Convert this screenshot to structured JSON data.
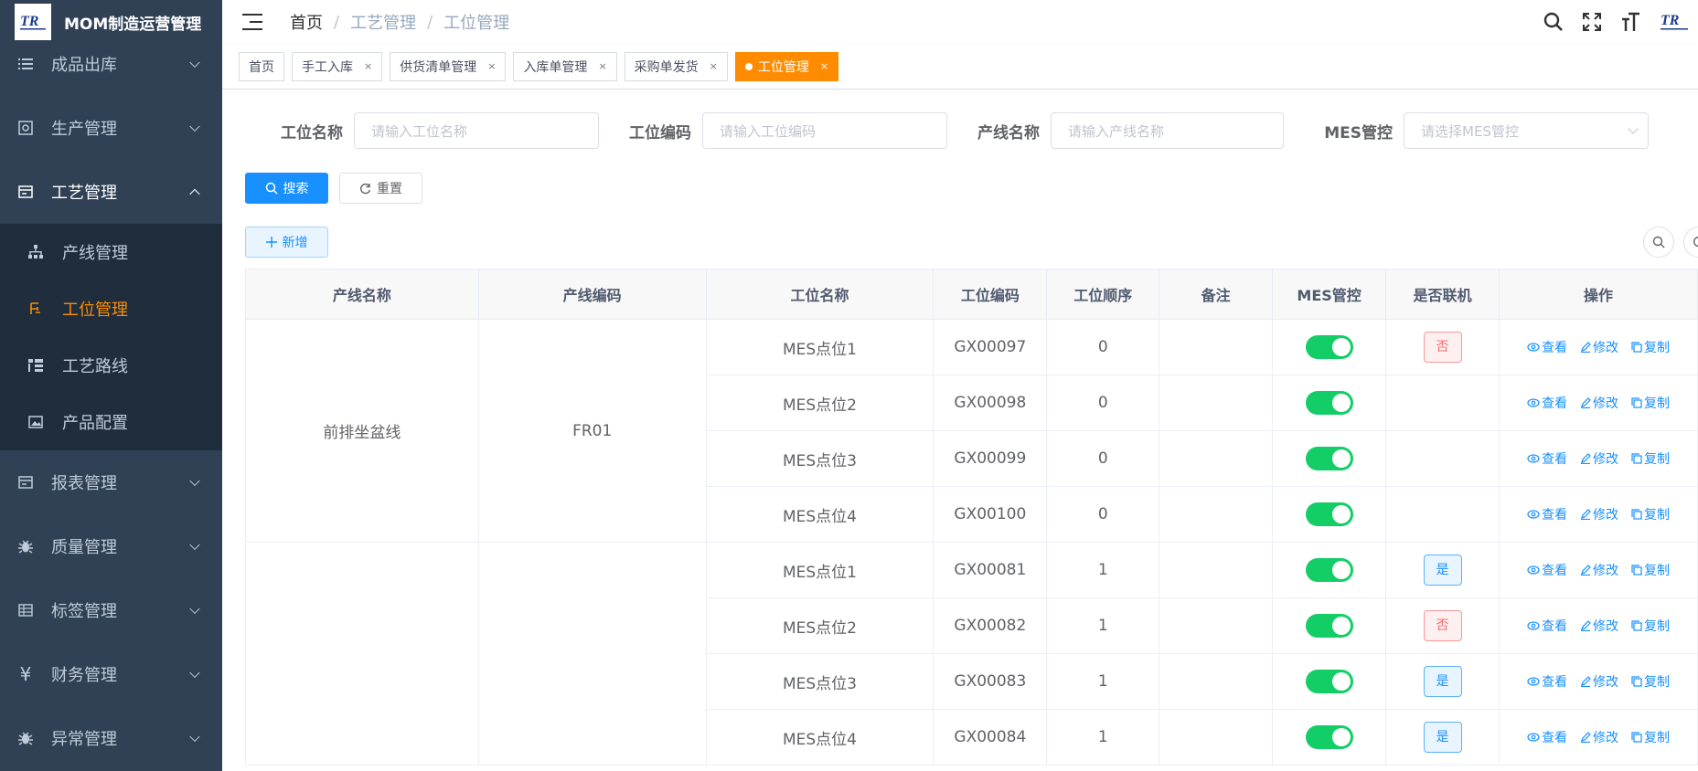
{
  "app": {
    "title": "MOM制造运营管理",
    "logo_text": "TR"
  },
  "sidebar": {
    "items": [
      {
        "label": "成品出库",
        "icon": "list-icon"
      },
      {
        "label": "生产管理",
        "icon": "factory-icon"
      },
      {
        "label": "工艺管理",
        "icon": "process-icon",
        "open": true
      },
      {
        "label": "报表管理",
        "icon": "report-icon"
      },
      {
        "label": "质量管理",
        "icon": "bug-icon"
      },
      {
        "label": "标签管理",
        "icon": "table-icon"
      },
      {
        "label": "财务管理",
        "icon": "yen-icon"
      },
      {
        "label": "异常管理",
        "icon": "bug-icon"
      }
    ],
    "sub_items": [
      {
        "label": "产线管理",
        "icon": "tree-icon"
      },
      {
        "label": "工位管理",
        "icon": "station-icon",
        "active": true
      },
      {
        "label": "工艺路线",
        "icon": "route-icon"
      },
      {
        "label": "产品配置",
        "icon": "image-icon"
      }
    ]
  },
  "breadcrumb": [
    "首页",
    "工艺管理",
    "工位管理"
  ],
  "tabs": [
    {
      "label": "首页",
      "closable": false
    },
    {
      "label": "手工入库",
      "closable": true
    },
    {
      "label": "供货清单管理",
      "closable": true
    },
    {
      "label": "入库单管理",
      "closable": true
    },
    {
      "label": "采购单发货",
      "closable": true
    },
    {
      "label": "工位管理",
      "closable": true,
      "active": true
    }
  ],
  "tab_close": "×",
  "filters": {
    "station_name": {
      "label": "工位名称",
      "placeholder": "请输入工位名称"
    },
    "station_code": {
      "label": "工位编码",
      "placeholder": "请输入工位编码"
    },
    "line_name": {
      "label": "产线名称",
      "placeholder": "请输入产线名称"
    },
    "mes_control": {
      "label": "MES管控",
      "placeholder": "请选择MES管控"
    }
  },
  "buttons": {
    "search": "搜索",
    "reset": "重置",
    "add": "新增"
  },
  "table": {
    "columns": [
      "产线名称",
      "产线编码",
      "工位名称",
      "工位编码",
      "工位顺序",
      "备注",
      "MES管控",
      "是否联机",
      "操作"
    ],
    "actions": {
      "view": "查看",
      "edit": "修改",
      "copy": "复制"
    },
    "groups": [
      {
        "line_name": "前排坐盆线",
        "line_code": "FR01",
        "rows": [
          {
            "name": "MES点位1",
            "code": "GX00097",
            "order": "0",
            "remark": "",
            "mes": true,
            "online": "否"
          },
          {
            "name": "MES点位2",
            "code": "GX00098",
            "order": "0",
            "remark": "",
            "mes": true,
            "online": ""
          },
          {
            "name": "MES点位3",
            "code": "GX00099",
            "order": "0",
            "remark": "",
            "mes": true,
            "online": ""
          },
          {
            "name": "MES点位4",
            "code": "GX00100",
            "order": "0",
            "remark": "",
            "mes": true,
            "online": ""
          }
        ]
      },
      {
        "line_name": "",
        "line_code": "",
        "rows": [
          {
            "name": "MES点位1",
            "code": "GX00081",
            "order": "1",
            "remark": "",
            "mes": true,
            "online": "是"
          },
          {
            "name": "MES点位2",
            "code": "GX00082",
            "order": "1",
            "remark": "",
            "mes": true,
            "online": "否"
          },
          {
            "name": "MES点位3",
            "code": "GX00083",
            "order": "1",
            "remark": "",
            "mes": true,
            "online": "是"
          },
          {
            "name": "MES点位4",
            "code": "GX00084",
            "order": "1",
            "remark": "",
            "mes": true,
            "online": "是"
          }
        ]
      }
    ]
  },
  "colors": {
    "sidebar_bg": "#304156",
    "submenu_bg": "#1f2d3d",
    "accent_orange": "#ff8c00",
    "primary": "#1890ff",
    "switch_on": "#13ce66"
  }
}
